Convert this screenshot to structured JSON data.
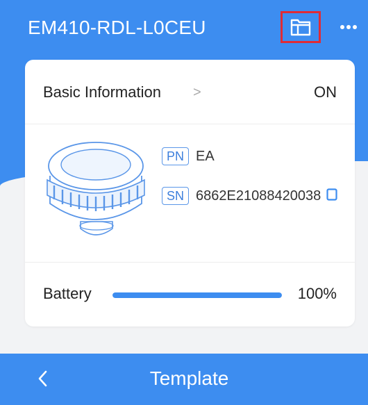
{
  "header": {
    "device_name": "EM410-RDL-L0CEU",
    "folder_icon": "folder-icon",
    "more_icon": "more-horizontal-icon"
  },
  "basic_info": {
    "label": "Basic Information",
    "chevron": ">",
    "status": "ON"
  },
  "device_info": {
    "image": "device-sensor-illustration",
    "pn_tag": "PN",
    "pn_value": "EA",
    "sn_tag": "SN",
    "sn_value": "6862E21088420038",
    "copy_icon": "copy-icon"
  },
  "battery": {
    "label": "Battery",
    "level": 1.0,
    "value": "100%"
  },
  "bottom_bar": {
    "back_icon": "chevron-left-icon",
    "title": "Template"
  },
  "colors": {
    "primary": "#3d8df0",
    "highlight_border": "#e02b35",
    "tag_border": "#5a96e8",
    "background": "#f2f3f5"
  }
}
